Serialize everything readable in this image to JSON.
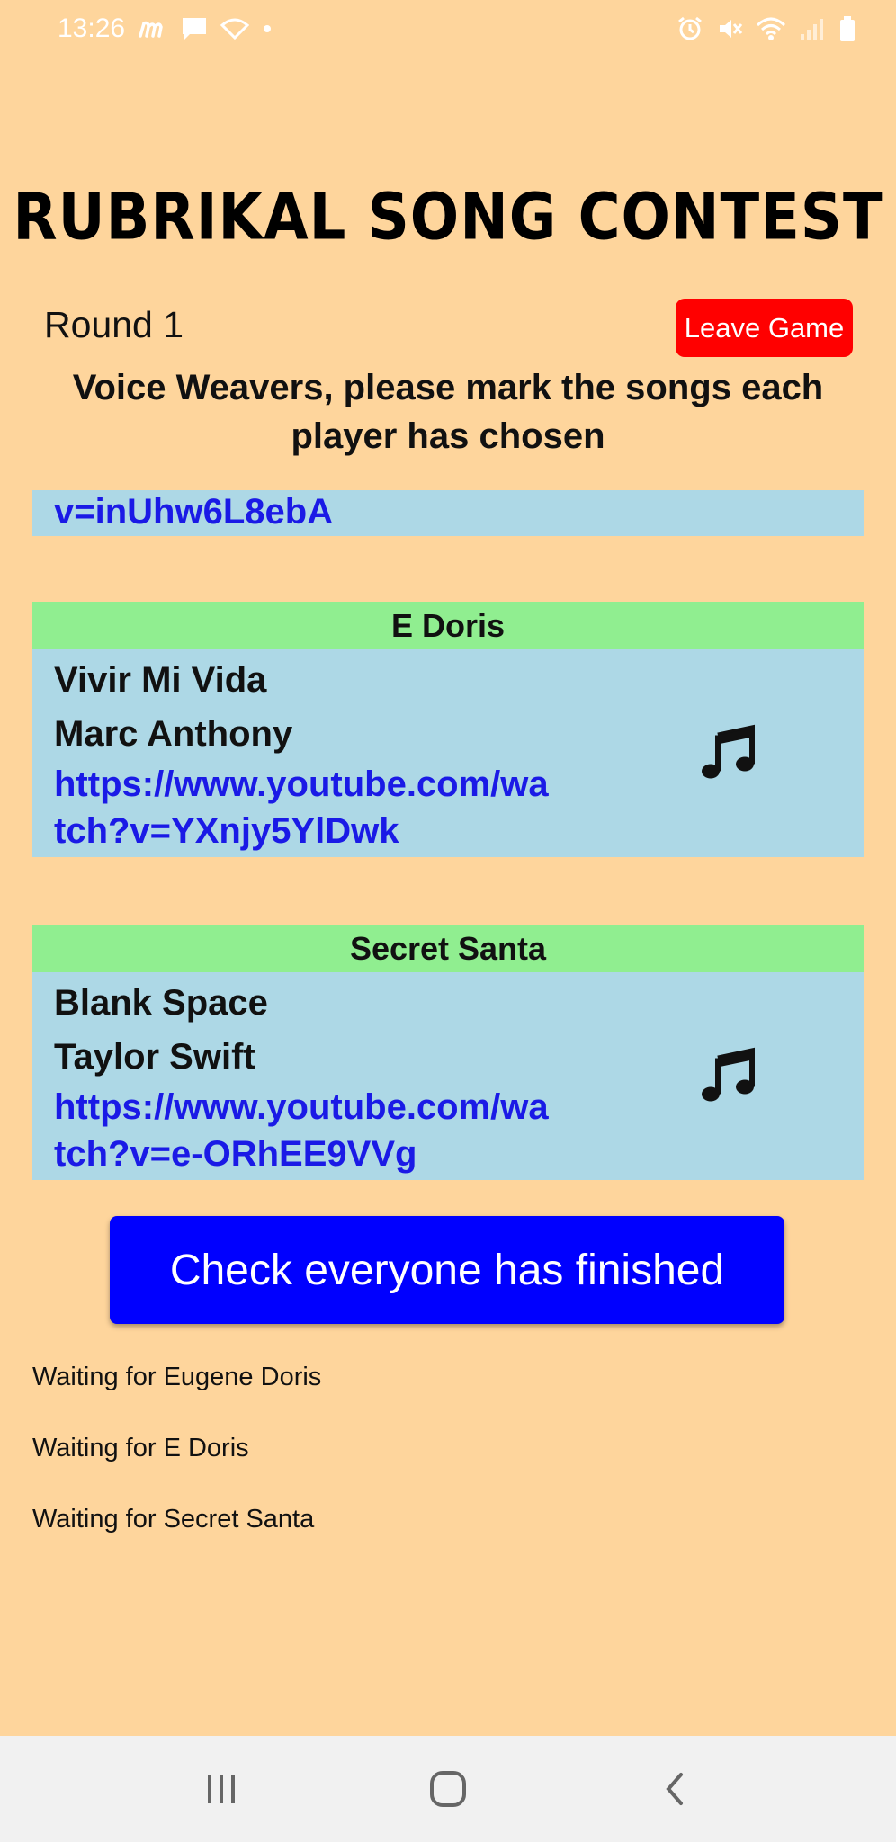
{
  "status_bar": {
    "time": "13:26",
    "left_icons": [
      "m-app-icon",
      "message-icon",
      "wifi-calling-icon",
      "dot-icon"
    ],
    "right_icons": [
      "alarm-icon",
      "mute-icon",
      "wifi-icon",
      "signal-icon",
      "battery-icon"
    ]
  },
  "app": {
    "title": "RUBRIKAL SONG CONTEST",
    "round": "Round 1",
    "leave_label": "Leave Game",
    "instruction": "Voice Weavers, please mark the songs each player has chosen"
  },
  "partial_card": {
    "link_tail": "v=inUhw6L8ebA"
  },
  "songs": [
    {
      "player": "E Doris",
      "title": "Vivir Mi Vida",
      "artist": "Marc Anthony",
      "link": "https://www.youtube.com/watch?v=YXnjy5YlDwk",
      "icon": "music-note-icon"
    },
    {
      "player": "Secret Santa",
      "title": "Blank Space",
      "artist": "Taylor Swift",
      "link": "https://www.youtube.com/watch?v=e-ORhEE9VVg",
      "icon": "music-note-icon"
    }
  ],
  "check_label": "Check everyone has finished",
  "waiting": [
    "Waiting for Eugene Doris",
    "Waiting for E Doris",
    "Waiting for Secret Santa"
  ],
  "nav_bar": {
    "items": [
      "recent-apps-icon",
      "home-icon",
      "back-icon"
    ]
  },
  "colors": {
    "background": "#fed59c",
    "card_body": "#add8e6",
    "card_header": "#90ee90",
    "link": "#1a1ae6",
    "leave_button": "#ff0000",
    "check_button": "#0000ff"
  }
}
